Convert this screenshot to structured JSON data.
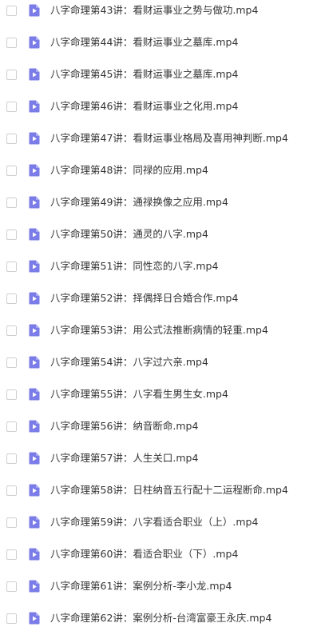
{
  "colors": {
    "icon_fill": "#7b7ce8",
    "icon_play": "#ffffff",
    "text": "#333333",
    "checkbox_border": "#cfcfcf"
  },
  "files": [
    {
      "name": "八字命理第43讲：看财运事业之势与做功.mp4",
      "icon": "video-file-icon",
      "checked": false
    },
    {
      "name": "八字命理第44讲：看财运事业之墓库.mp4",
      "icon": "video-file-icon",
      "checked": false
    },
    {
      "name": "八字命理第45讲：看财运事业之墓库.mp4",
      "icon": "video-file-icon",
      "checked": false
    },
    {
      "name": "八字命理第46讲：看财运事业之化用.mp4",
      "icon": "video-file-icon",
      "checked": false
    },
    {
      "name": "八字命理第47讲：看财运事业格局及喜用神判断.mp4",
      "icon": "video-file-icon",
      "checked": false
    },
    {
      "name": "八字命理第48讲：同禄的应用.mp4",
      "icon": "video-file-icon",
      "checked": false
    },
    {
      "name": "八字命理第49讲：通禄换像之应用.mp4",
      "icon": "video-file-icon",
      "checked": false
    },
    {
      "name": "八字命理第50讲：通灵的八字.mp4",
      "icon": "video-file-icon",
      "checked": false
    },
    {
      "name": "八字命理第51讲：同性恋的八字.mp4",
      "icon": "video-file-icon",
      "checked": false
    },
    {
      "name": "八字命理第52讲：择偶择日合婚合作.mp4",
      "icon": "video-file-icon",
      "checked": false
    },
    {
      "name": "八字命理第53讲：用公式法推断病情的轻重.mp4",
      "icon": "video-file-icon",
      "checked": false
    },
    {
      "name": "八字命理第54讲：八字过六亲.mp4",
      "icon": "video-file-icon",
      "checked": false
    },
    {
      "name": "八字命理第55讲：八字看生男生女.mp4",
      "icon": "video-file-icon",
      "checked": false
    },
    {
      "name": "八字命理第56讲：纳音断命.mp4",
      "icon": "video-file-icon",
      "checked": false
    },
    {
      "name": "八字命理第57讲：人生关口.mp4",
      "icon": "video-file-icon",
      "checked": false
    },
    {
      "name": "八字命理第58讲：日柱纳音五行配十二运程断命.mp4",
      "icon": "video-file-icon",
      "checked": false
    },
    {
      "name": "八字命理第59讲：八字看适合职业（上）.mp4",
      "icon": "video-file-icon",
      "checked": false
    },
    {
      "name": "八字命理第60讲：看适合职业（下）.mp4",
      "icon": "video-file-icon",
      "checked": false
    },
    {
      "name": "八字命理第61讲：案例分析-李小龙.mp4",
      "icon": "video-file-icon",
      "checked": false
    },
    {
      "name": "八字命理第62讲：案例分析-台湾富豪王永庆.mp4",
      "icon": "video-file-icon",
      "checked": false
    }
  ]
}
